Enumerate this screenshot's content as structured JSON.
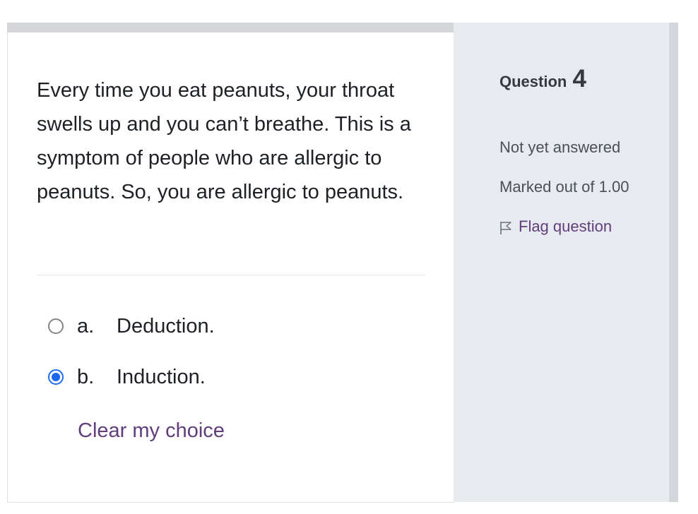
{
  "question": {
    "text": "Every time you eat peanuts, your throat swells up and you can’t breathe. This is a symptom of people who are allergic to peanuts. So, you are allergic to peanuts.",
    "answers": [
      {
        "letter": "a.",
        "label": "Deduction.",
        "selected": false
      },
      {
        "letter": "b.",
        "label": "Induction.",
        "selected": true
      }
    ],
    "clear_label": "Clear my choice"
  },
  "info": {
    "question_label": "Question",
    "question_number": "4",
    "state": "Not yet answered",
    "grade": "Marked out of 1.00",
    "flag_label": "Flag question",
    "flag_icon": "flag-outline-icon"
  },
  "colors": {
    "link": "#613d7c",
    "radio_checked": "#1a66ed",
    "info_bg": "#e7eaee"
  }
}
